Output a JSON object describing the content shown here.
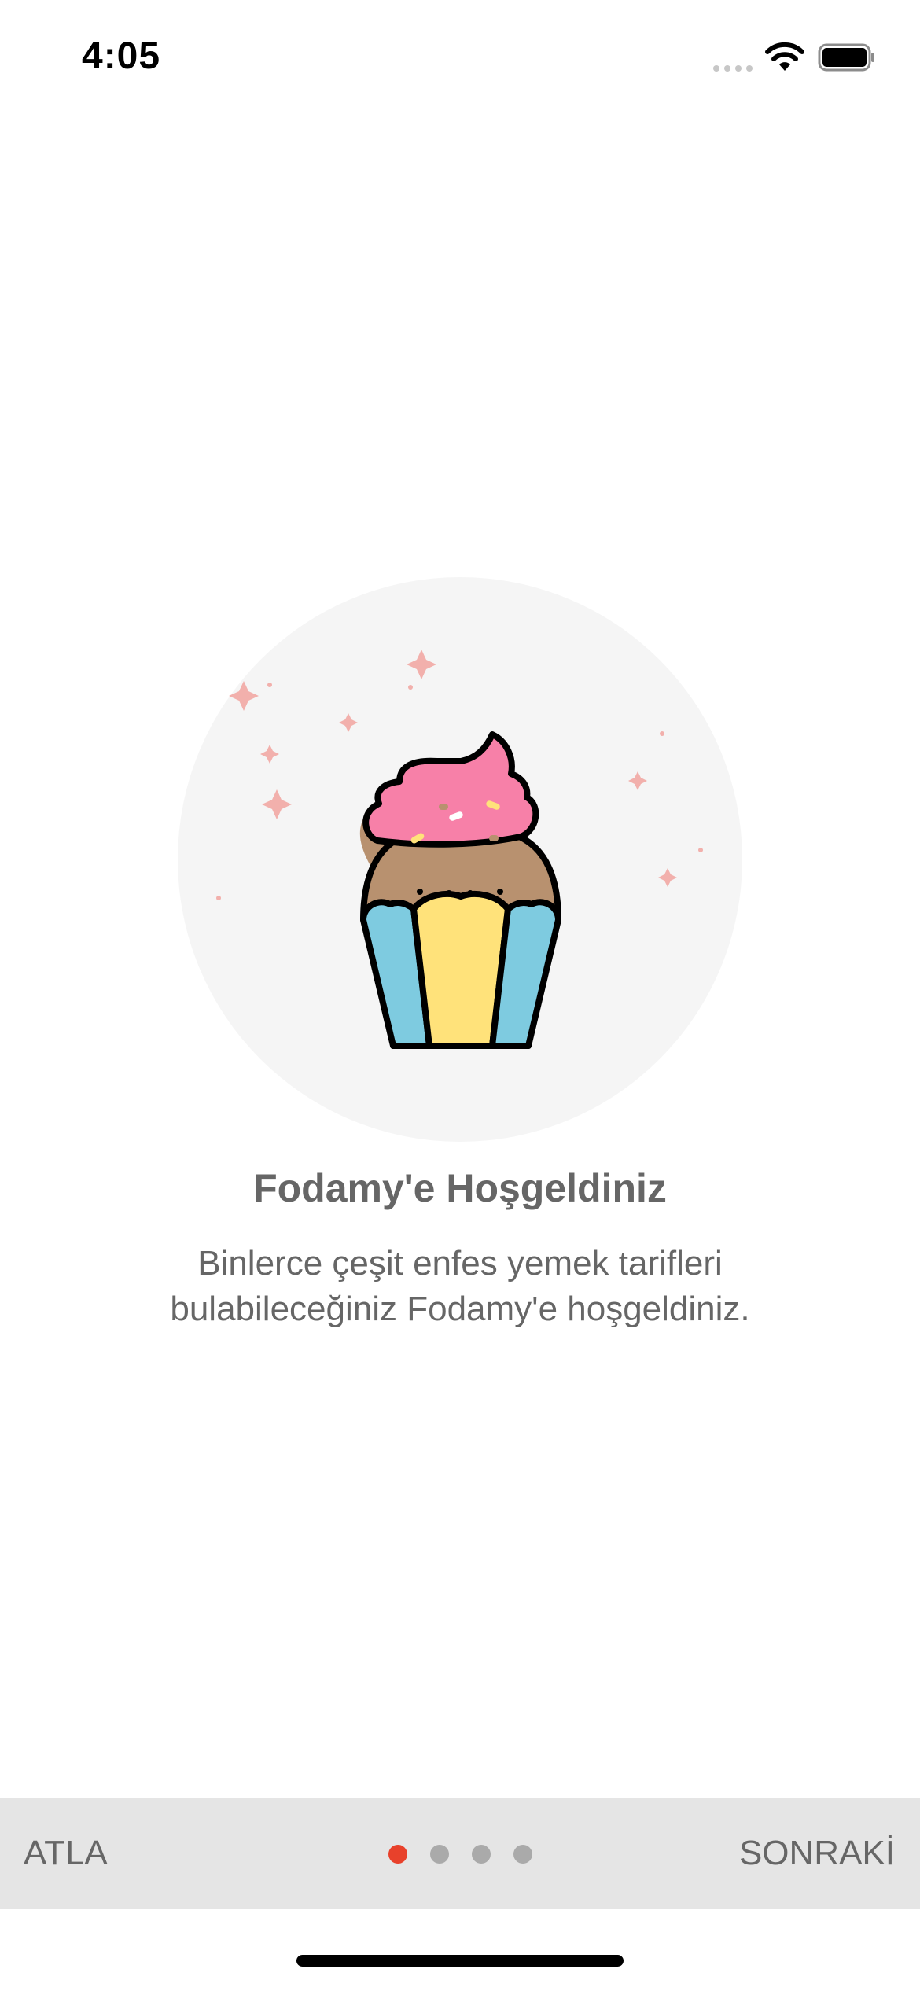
{
  "status_bar": {
    "time": "4:05",
    "icons": [
      "cellular-signal-icon",
      "wifi-icon",
      "battery-icon"
    ]
  },
  "onboarding": {
    "illustration": "cupcake-illustration",
    "title": "Fodamy'e Hoşgeldiniz",
    "description": "Binlerce çeşit enfes yemek tarifleri bulabileceğiniz Fodamy'e hoşgeldiniz."
  },
  "bottom_bar": {
    "skip_label": "ATLA",
    "next_label": "SONRAKİ",
    "page_count": 4,
    "current_page": 1
  },
  "colors": {
    "accent": "#e8412b",
    "text": "#666666",
    "bar_background": "#e5e5e5",
    "circle_background": "#f5f5f5"
  }
}
